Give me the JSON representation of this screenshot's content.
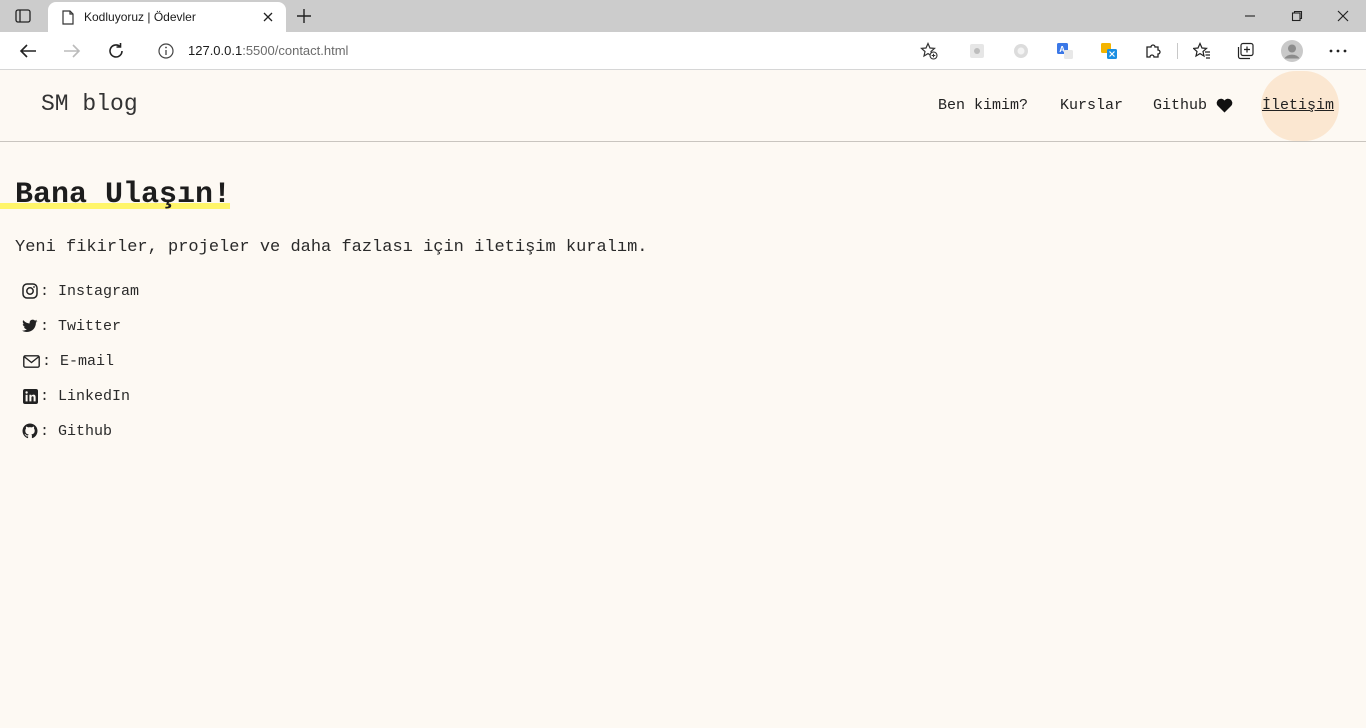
{
  "browser": {
    "tab_title": "Kodluyoruz | Ödevler",
    "url_host": "127.0.0.1",
    "url_path": ":5500/contact.html"
  },
  "site": {
    "brand": "SM blog",
    "nav": [
      {
        "label": "Ben kimim?"
      },
      {
        "label": "Kurslar"
      },
      {
        "label": "Github"
      },
      {
        "label": "İletişim"
      }
    ]
  },
  "page": {
    "title": "Bana Ulaşın!",
    "intro": "Yeni fikirler, projeler ve daha fazlası için iletişim kuralım."
  },
  "contacts": [
    {
      "label": ": Instagram",
      "icon": "instagram-icon"
    },
    {
      "label": ": Twitter",
      "icon": "twitter-icon"
    },
    {
      "label": ": E-mail",
      "icon": "envelope-icon"
    },
    {
      "label": ": LinkedIn",
      "icon": "linkedin-icon"
    },
    {
      "label": ": Github",
      "icon": "github-icon"
    }
  ],
  "colors": {
    "page_bg": "#fdf9f3",
    "title_highlight": "#fff56a",
    "active_nav_bg": "#fbe7d1"
  }
}
